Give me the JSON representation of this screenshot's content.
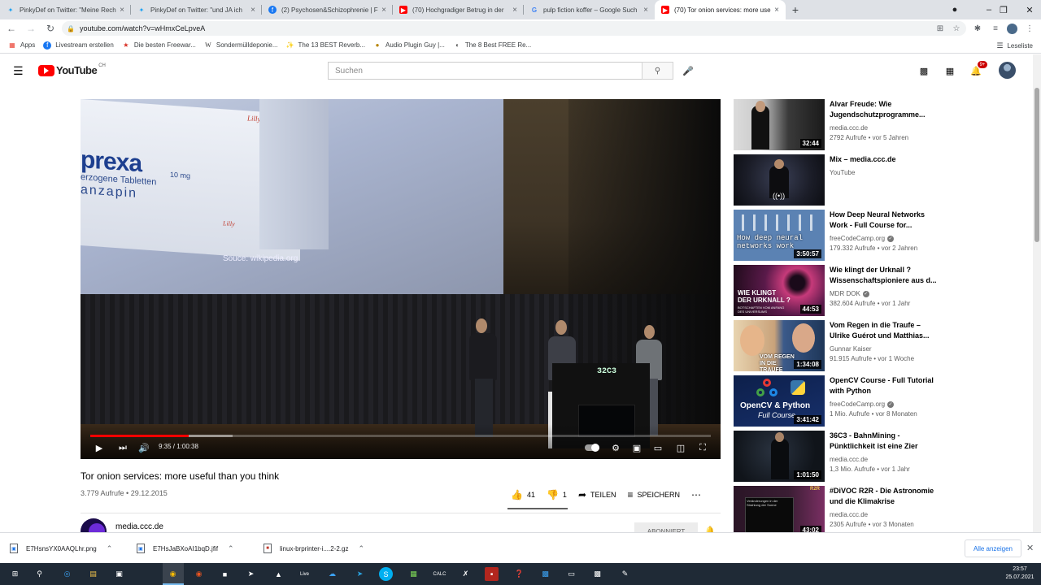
{
  "browser": {
    "tabs": [
      {
        "title": "PinkyDef on Twitter: \"Meine Rech",
        "icon": "twitter-icon"
      },
      {
        "title": "PinkyDef on Twitter: \"und JA ich",
        "icon": "twitter-icon"
      },
      {
        "title": "(2) Psychosen&Schizophrenie | Fa",
        "icon": "facebook-icon"
      },
      {
        "title": "(70) Hochgradiger Betrug in der",
        "icon": "youtube-icon"
      },
      {
        "title": "pulp fiction koffer – Google Such",
        "icon": "google-icon"
      },
      {
        "title": "(70) Tor onion services: more use",
        "icon": "youtube-icon"
      }
    ],
    "url": "youtube.com/watch?v=wHmxCeLpveA",
    "bookmarks": [
      {
        "label": "Apps"
      },
      {
        "label": "Livestream erstellen"
      },
      {
        "label": "Die besten Freewar..."
      },
      {
        "label": "Sondermülldeponie..."
      },
      {
        "label": "The 13 BEST Reverb..."
      },
      {
        "label": "Audio Plugin Guy |..."
      },
      {
        "label": "The 8 Best FREE Re..."
      }
    ],
    "reading_list": "Leseliste"
  },
  "youtube": {
    "logo": "YouTube",
    "region": "CH",
    "search_placeholder": "Suchen",
    "notifications": "9+",
    "video": {
      "slide_brand": "prexa",
      "slide_dose": "10 mg",
      "slide_line1": "erzogene Tabletten",
      "slide_line2": "anzapin",
      "slide_lilly": "Lilly",
      "slide_source": "Souce: wikipedia.org",
      "lectern_logo": "32C3",
      "time": "9:35 / 1:00:38",
      "played_fraction": 0.158,
      "title": "Tor onion services: more useful than you think",
      "meta": "3.779 Aufrufe • 29.12.2015",
      "likes": "41",
      "dislikes": "1",
      "share": "TEILEN",
      "save": "SPEICHERN",
      "channel": "media.ccc.de",
      "subscribe": "ABONNIERT"
    },
    "recommendations": [
      {
        "title1": "Alvar Freude: Wie",
        "title2": "Jugendschutzprogramme...",
        "channel": "media.ccc.de",
        "verified": false,
        "views": "2792 Aufrufe • vor 5 Jahren",
        "duration": "32:44"
      },
      {
        "title1": "Mix – media.ccc.de",
        "title2": "",
        "channel": "YouTube",
        "verified": false,
        "views": "",
        "duration": ""
      },
      {
        "title1": "How Deep Neural Networks",
        "title2": "Work - Full Course for...",
        "channel": "freeCodeCamp.org",
        "verified": true,
        "views": "179.332 Aufrufe • vor 2 Jahren",
        "duration": "3:50:57"
      },
      {
        "title1": "Wie klingt der Urknall ?",
        "title2": "Wissenschaftspioniere aus d...",
        "channel": "MDR DOK",
        "verified": true,
        "views": "382.604 Aufrufe • vor 1 Jahr",
        "duration": "44:53"
      },
      {
        "title1": "Vom Regen in die Traufe –",
        "title2": "Ulrike Guérot und Matthias...",
        "channel": "Gunnar Kaiser",
        "verified": false,
        "views": "91.915 Aufrufe • vor 1 Woche",
        "duration": "1:34:08"
      },
      {
        "title1": "OpenCV Course - Full Tutorial",
        "title2": "with Python",
        "channel": "freeCodeCamp.org",
        "verified": true,
        "views": "1 Mio. Aufrufe • vor 8 Monaten",
        "duration": "3:41:42"
      },
      {
        "title1": "36C3 - BahnMining -",
        "title2": "Pünktlichkeit ist eine Zier",
        "channel": "media.ccc.de",
        "verified": false,
        "views": "1,3 Mio. Aufrufe • vor 1 Jahr",
        "duration": "1:01:50"
      },
      {
        "title1": "#DiVOC R2R - Die Astronomie",
        "title2": "und die Klimakrise",
        "channel": "media.ccc.de",
        "verified": false,
        "views": "2305 Aufrufe • vor 3 Monaten",
        "duration": "43:02"
      }
    ],
    "thumb_texts": {
      "neural": "How deep neural networks work",
      "urknall1": "WIE KLINGT",
      "urknall2": "DER URKNALL ?",
      "urknall3": "BOTSCHAFTEN VOM ANFANG DES UNIVERSUMS",
      "regen": "VOM REGEN IN DIE TRAUFE",
      "opencv1": "OpenCV & Python",
      "opencv2": "Full Course",
      "divoc": "Veränderungen in der Strahlung der Sonne",
      "divoc_tag": "R2R"
    }
  },
  "downloads": {
    "files": [
      {
        "name": "E7HsnsYX0AAQLhr.png"
      },
      {
        "name": "E7HsJaBXoAI1bqD.jfif"
      },
      {
        "name": "linux-brprinter-i....2-2.gz"
      }
    ],
    "show_all": "Alle anzeigen"
  },
  "taskbar": {
    "time": "23:57",
    "date": "25.07.2021"
  },
  "colors": {
    "youtube_red": "#ff0000",
    "progress_red": "#ff0000",
    "download_link_blue": "#1a73e8",
    "taskbar_bg": "#1f2a36"
  }
}
